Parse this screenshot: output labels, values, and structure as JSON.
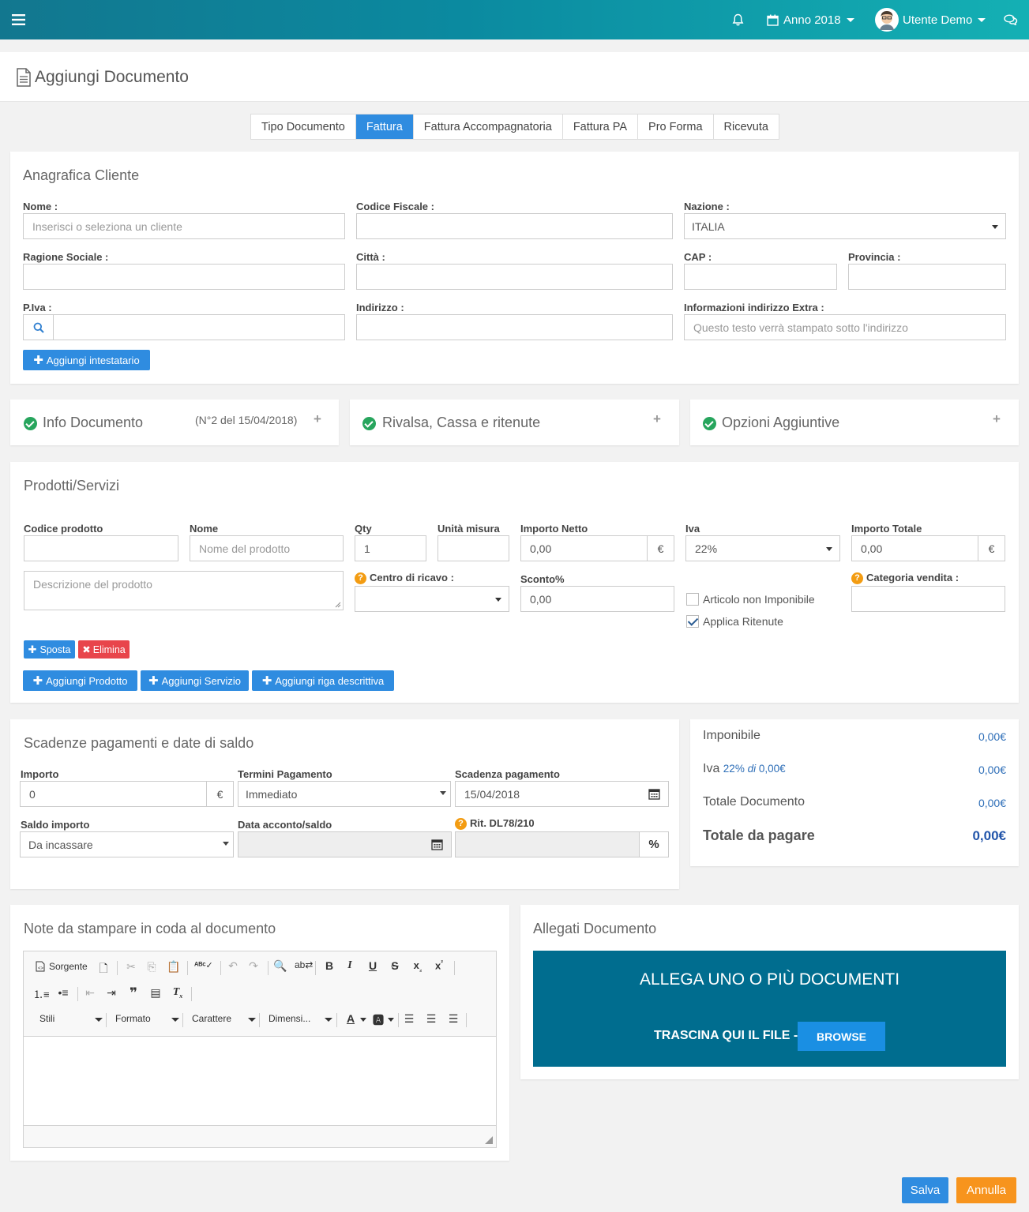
{
  "topbar": {
    "year_label": "Anno 2018",
    "user_label": "Utente Demo"
  },
  "page": {
    "title": "Aggiungi Documento"
  },
  "tabs": [
    "Tipo Documento",
    "Fattura",
    "Fattura Accompagnatoria",
    "Fattura PA",
    "Pro Forma",
    "Ricevuta"
  ],
  "cliente": {
    "title": "Anagrafica Cliente",
    "nome_label": "Nome :",
    "nome_placeholder": "Inserisci o seleziona un cliente",
    "cf_label": "Codice Fiscale :",
    "nazione_label": "Nazione :",
    "nazione_value": "ITALIA",
    "ragione_label": "Ragione Sociale :",
    "citta_label": "Città :",
    "cap_label": "CAP :",
    "provincia_label": "Provincia :",
    "piva_label": "P.Iva :",
    "indirizzo_label": "Indirizzo :",
    "extra_label": "Informazioni indirizzo Extra :",
    "extra_placeholder": "Questo testo verrà stampato sotto l'indirizzo",
    "add_button": "Aggiungi intestatario"
  },
  "collapsibles": {
    "info_title": "Info Documento",
    "info_meta": "(N°2 del 15/04/2018)",
    "rivalsa_title": "Rivalsa, Cassa e ritenute",
    "opzioni_title": "Opzioni Aggiuntive"
  },
  "prodotti": {
    "title": "Prodotti/Servizi",
    "codice_label": "Codice prodotto",
    "nome_label": "Nome",
    "nome_placeholder": "Nome del prodotto",
    "qty_label": "Qty",
    "qty_value": "1",
    "unita_label": "Unità misura",
    "netto_label": "Importo Netto",
    "netto_value": "0,00",
    "currency": "€",
    "iva_label": "Iva",
    "iva_value": "22%",
    "totale_label": "Importo Totale",
    "totale_value": "0,00",
    "descr_placeholder": "Descrizione del prodotto",
    "centro_label": "Centro di ricavo :",
    "sconto_label": "Sconto%",
    "sconto_value": "0,00",
    "non_imponibile_label": "Articolo non Imponibile",
    "ritenute_label": "Applica Ritenute",
    "categoria_label": "Categoria vendita :",
    "sposta_button": "Sposta",
    "elimina_button": "Elimina",
    "add_prodotto": "Aggiungi Prodotto",
    "add_servizio": "Aggiungi Servizio",
    "add_riga": "Aggiungi riga descrittiva"
  },
  "scadenze": {
    "title": "Scadenze pagamenti e date di saldo",
    "importo_label": "Importo",
    "importo_value": "0",
    "termini_label": "Termini Pagamento",
    "termini_value": "Immediato",
    "scadenza_label": "Scadenza pagamento",
    "scadenza_value": "15/04/2018",
    "saldo_label": "Saldo importo",
    "saldo_value": "Da incassare",
    "data_label": "Data acconto/saldo",
    "rit_label": "Rit. DL78/210",
    "percent": "%"
  },
  "riepilogo": {
    "imponibile_label": "Imponibile",
    "imponibile_value": "0,00€",
    "iva_label": "Iva",
    "iva_detail_pct": "22%",
    "iva_detail_di": "di",
    "iva_detail_base": "0,00€",
    "iva_value": "0,00€",
    "totale_doc_label": "Totale Documento",
    "totale_doc_value": "0,00€",
    "totale_pagare_label": "Totale da pagare",
    "totale_pagare_value": "0,00€"
  },
  "note": {
    "title": "Note da stampare in coda al documento",
    "sorgente": "Sorgente",
    "stili": "Stili",
    "formato": "Formato",
    "carattere": "Carattere",
    "dimensione": "Dimensi..."
  },
  "allegati": {
    "title": "Allegati Documento",
    "drop_title": "ALLEGA UNO O PIÙ DOCUMENTI",
    "drop_text": "TRASCINA QUI IL FILE -",
    "browse": "BROWSE"
  },
  "footer": {
    "salva": "Salva",
    "annulla": "Annulla"
  },
  "colors": {
    "primary": "#2f8ce0",
    "danger": "#e8454b",
    "warning": "#f39c12",
    "success": "#27a55d",
    "dropzone": "#006d8f"
  }
}
